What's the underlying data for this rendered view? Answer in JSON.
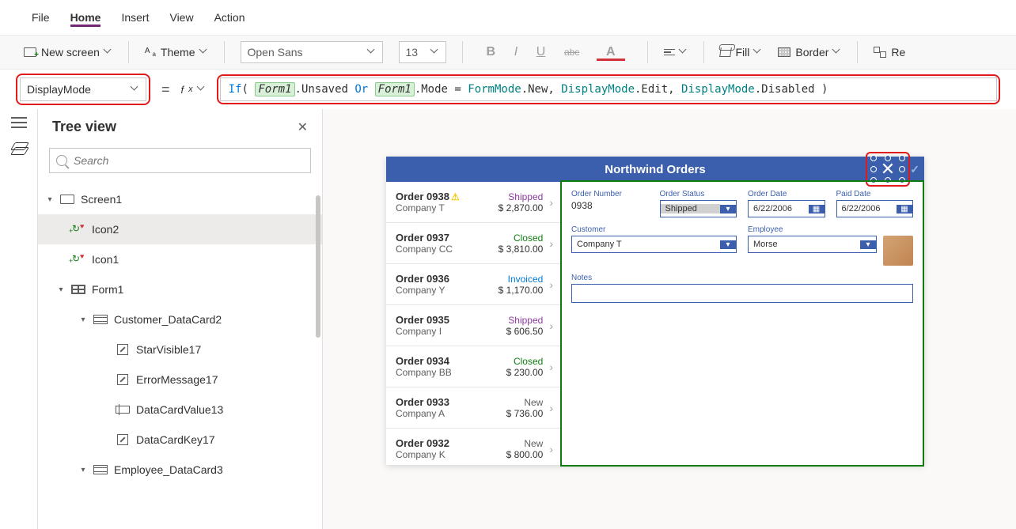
{
  "menu": {
    "items": [
      "File",
      "Home",
      "Insert",
      "View",
      "Action"
    ],
    "active": "Home"
  },
  "ribbon": {
    "new_screen": "New screen",
    "theme": "Theme",
    "font_name": "Open Sans",
    "font_size": "13",
    "fill": "Fill",
    "border": "Border",
    "reorder": "Re"
  },
  "formula": {
    "property": "DisplayMode",
    "tokens": [
      {
        "t": "fn",
        "v": "If"
      },
      {
        "t": "text",
        "v": "( "
      },
      {
        "t": "ref",
        "v": "Form1"
      },
      {
        "t": "text",
        "v": ".Unsaved "
      },
      {
        "t": "kw",
        "v": "Or"
      },
      {
        "t": "text",
        "v": " "
      },
      {
        "t": "ref",
        "v": "Form1"
      },
      {
        "t": "text",
        "v": ".Mode = "
      },
      {
        "t": "type",
        "v": "FormMode"
      },
      {
        "t": "text",
        "v": ".New, "
      },
      {
        "t": "type",
        "v": "DisplayMode"
      },
      {
        "t": "text",
        "v": ".Edit, "
      },
      {
        "t": "type",
        "v": "DisplayMode"
      },
      {
        "t": "text",
        "v": ".Disabled )"
      }
    ]
  },
  "tree": {
    "title": "Tree view",
    "search_placeholder": "Search",
    "items": [
      {
        "indent": 0,
        "icon": "screen",
        "label": "Screen1",
        "expanded": true,
        "selected": false
      },
      {
        "indent": 1,
        "icon": "recycle",
        "label": "Icon2",
        "expanded": false,
        "selected": true
      },
      {
        "indent": 1,
        "icon": "recycle",
        "label": "Icon1",
        "expanded": false,
        "selected": false
      },
      {
        "indent": 1,
        "icon": "form",
        "label": "Form1",
        "expanded": true,
        "selected": false
      },
      {
        "indent": 2,
        "icon": "card",
        "label": "Customer_DataCard2",
        "expanded": true,
        "selected": false
      },
      {
        "indent": 3,
        "icon": "edit",
        "label": "StarVisible17",
        "expanded": false,
        "selected": false
      },
      {
        "indent": 3,
        "icon": "edit",
        "label": "ErrorMessage17",
        "expanded": false,
        "selected": false
      },
      {
        "indent": 3,
        "icon": "input",
        "label": "DataCardValue13",
        "expanded": false,
        "selected": false
      },
      {
        "indent": 3,
        "icon": "edit",
        "label": "DataCardKey17",
        "expanded": false,
        "selected": false
      },
      {
        "indent": 2,
        "icon": "card",
        "label": "Employee_DataCard3",
        "expanded": true,
        "selected": false
      }
    ]
  },
  "app": {
    "title": "Northwind Orders",
    "orders": [
      {
        "num": "Order 0938",
        "warn": true,
        "company": "Company T",
        "status": "Shipped",
        "status_class": "shipped",
        "amount": "$ 2,870.00"
      },
      {
        "num": "Order 0937",
        "warn": false,
        "company": "Company CC",
        "status": "Closed",
        "status_class": "closed",
        "amount": "$ 3,810.00"
      },
      {
        "num": "Order 0936",
        "warn": false,
        "company": "Company Y",
        "status": "Invoiced",
        "status_class": "invoiced",
        "amount": "$ 1,170.00"
      },
      {
        "num": "Order 0935",
        "warn": false,
        "company": "Company I",
        "status": "Shipped",
        "status_class": "shipped",
        "amount": "$ 606.50"
      },
      {
        "num": "Order 0934",
        "warn": false,
        "company": "Company BB",
        "status": "Closed",
        "status_class": "closed",
        "amount": "$ 230.00"
      },
      {
        "num": "Order 0933",
        "warn": false,
        "company": "Company A",
        "status": "New",
        "status_class": "new",
        "amount": "$ 736.00"
      },
      {
        "num": "Order 0932",
        "warn": false,
        "company": "Company K",
        "status": "New",
        "status_class": "new",
        "amount": "$ 800.00"
      }
    ],
    "form": {
      "order_number": {
        "label": "Order Number",
        "value": "0938"
      },
      "order_status": {
        "label": "Order Status",
        "value": "Shipped"
      },
      "order_date": {
        "label": "Order Date",
        "value": "6/22/2006"
      },
      "paid_date": {
        "label": "Paid Date",
        "value": "6/22/2006"
      },
      "customer": {
        "label": "Customer",
        "value": "Company T"
      },
      "employee": {
        "label": "Employee",
        "value": "Morse"
      },
      "notes": {
        "label": "Notes",
        "value": ""
      }
    }
  }
}
